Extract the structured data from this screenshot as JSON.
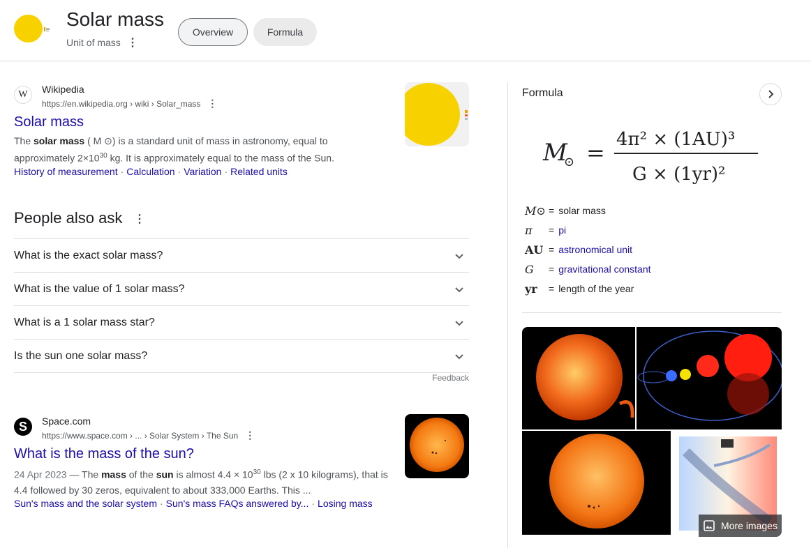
{
  "header": {
    "title": "Solar mass",
    "subtitle": "Unit of mass",
    "tabs": [
      {
        "label": "Overview"
      },
      {
        "label": "Formula"
      }
    ]
  },
  "results": [
    {
      "site_name": "Wikipedia",
      "icon": "W",
      "url": "https://en.wikipedia.org › wiki › Solar_mass",
      "title": "Solar mass",
      "snippet_parts": {
        "pre": "The ",
        "bold": "solar mass",
        "mid": " ( M ⊙) is a standard unit of mass in astronomy, equal to approximately 2×10",
        "sup": "30",
        "post": " kg. It is approximately equal to the mass of the Sun."
      },
      "sitelinks": [
        "History of measurement",
        "Calculation",
        "Variation",
        "Related units"
      ]
    },
    {
      "site_name": "Space.com",
      "icon": "S",
      "url": "https://www.space.com › ... › Solar System › The Sun",
      "title": "What is the mass of the sun?",
      "snippet_parts": {
        "date": "24 Apr 2023",
        "dash": " — The ",
        "bold1": "mass",
        "t1": " of the ",
        "bold2": "sun",
        "t2": " is almost 4.4 × 10",
        "sup": "30",
        "t3": " lbs (2 x 10 kilograms), that is 4.4 followed by 30 zeros, equivalent to about 333,000 Earths. This ..."
      },
      "sitelinks": [
        "Sun's mass and the solar system",
        "Sun's mass FAQs answered by...",
        "Losing mass"
      ]
    }
  ],
  "people_also_ask": {
    "title": "People also ask",
    "questions": [
      "What is the exact solar mass?",
      "What is the value of 1 solar mass?",
      "What is a 1 solar mass star?",
      "Is the sun one solar mass?"
    ],
    "feedback": "Feedback"
  },
  "formula_panel": {
    "label": "Formula",
    "equation": {
      "lhs": "M",
      "lhs_sub": "⊙",
      "eq": "=",
      "num": "4π² × (1AU)³",
      "den": "G × (1yr)²"
    },
    "legend": [
      {
        "symbol": "M⊙",
        "eq": "=",
        "text": "solar mass",
        "link": false
      },
      {
        "symbol": "π",
        "eq": "=",
        "text": "pi",
        "link": true
      },
      {
        "symbol": "AU",
        "eq": "=",
        "text": "astronomical unit",
        "link": true
      },
      {
        "symbol": "G",
        "eq": "=",
        "text": "gravitational constant",
        "link": true
      },
      {
        "symbol": "yr",
        "eq": "=",
        "text": "length of the year",
        "link": false
      }
    ],
    "more_images": "More images"
  },
  "colors": {
    "link": "#1a0dab",
    "sun_yellow": "#f7d200",
    "divider": "#dadce0"
  }
}
